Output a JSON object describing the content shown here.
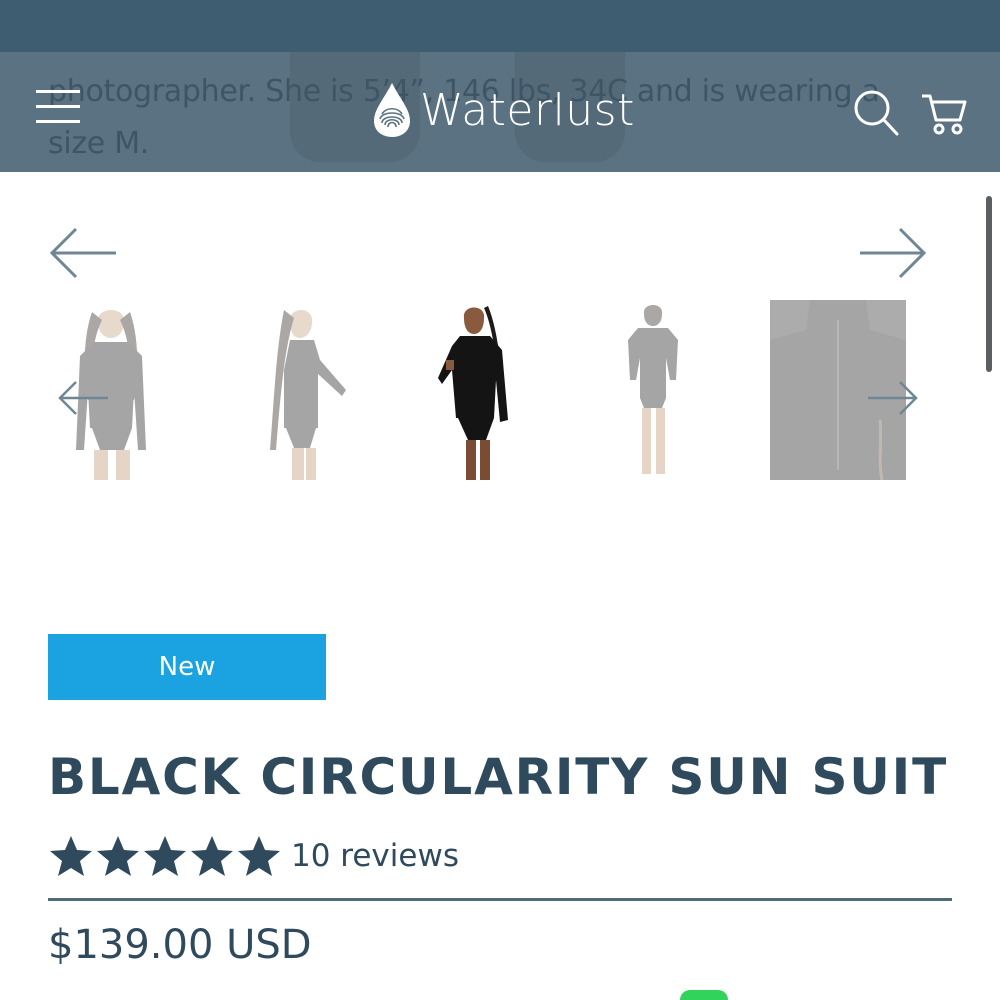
{
  "header": {
    "behind_text": "photographer. She is 5’4”, 146 lbs, 34C and is wearing a size M.",
    "brand_name": "Waterlust",
    "icons": {
      "menu": "hamburger-menu-icon",
      "logo": "water-drop-fingerprint-icon",
      "search": "search-icon",
      "cart": "cart-icon"
    },
    "background_color": "#5b7282"
  },
  "gallery": {
    "prev_icon": "arrow-left-icon",
    "next_icon": "arrow-right-icon",
    "thumbnails": [
      {
        "label": "front view",
        "selected": false
      },
      {
        "label": "side view",
        "selected": false
      },
      {
        "label": "three-quarter view",
        "selected": true
      },
      {
        "label": "back view",
        "selected": false
      },
      {
        "label": "back detail",
        "selected": false
      }
    ]
  },
  "product": {
    "badge": "New",
    "badge_color": "#1aa3e0",
    "title": "BLACK CIRCULARITY SUN SUIT",
    "rating": 5,
    "rating_max": 5,
    "reviews_label": "10 reviews",
    "price": "$139.00 USD"
  },
  "colors": {
    "text": "#2f4a5c",
    "top_strip": "#3f5d70"
  }
}
